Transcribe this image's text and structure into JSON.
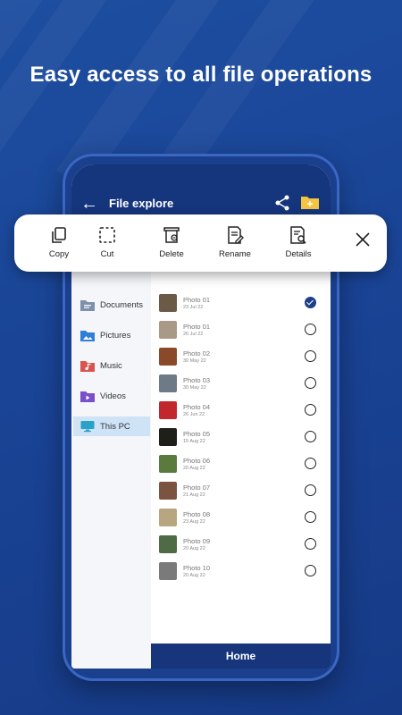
{
  "headline": "Easy access to all file operations",
  "appbar": {
    "title": "File explore"
  },
  "toolbar": {
    "items": [
      {
        "label": "Copy",
        "icon": "copy-icon"
      },
      {
        "label": "Cut",
        "icon": "cut-icon"
      },
      {
        "label": "Delete",
        "icon": "delete-icon"
      },
      {
        "label": "Rename",
        "icon": "rename-icon"
      },
      {
        "label": "Details",
        "icon": "details-icon"
      }
    ],
    "close_icon": "close-icon"
  },
  "sidebar": {
    "items": [
      {
        "label": "Documents",
        "icon": "documents-folder-icon",
        "color": "#7f8fae"
      },
      {
        "label": "Pictures",
        "icon": "pictures-folder-icon",
        "color": "#2f7fd8"
      },
      {
        "label": "Music",
        "icon": "music-folder-icon",
        "color": "#d9534f"
      },
      {
        "label": "Videos",
        "icon": "videos-folder-icon",
        "color": "#7b4fc9"
      },
      {
        "label": "This PC",
        "icon": "monitor-icon",
        "color": "#2aa1c9"
      }
    ],
    "active_index": 4
  },
  "photos": [
    {
      "name": "Photo 01",
      "date": "23 Jul 22",
      "checked": true,
      "thumb": "#6b5a45"
    },
    {
      "name": "Photo 01",
      "date": "26 Jul 22",
      "checked": false,
      "thumb": "#a89a86"
    },
    {
      "name": "Photo 02",
      "date": "30 May 22",
      "checked": false,
      "thumb": "#8a4a2a"
    },
    {
      "name": "Photo 03",
      "date": "30 May 22",
      "checked": false,
      "thumb": "#6e7a86"
    },
    {
      "name": "Photo 04",
      "date": "26 Jun 22",
      "checked": false,
      "thumb": "#c2272b"
    },
    {
      "name": "Photo 05",
      "date": "15 Aug 22",
      "checked": false,
      "thumb": "#1f1f1a"
    },
    {
      "name": "Photo 06",
      "date": "20 Aug 22",
      "checked": false,
      "thumb": "#5b7a3e"
    },
    {
      "name": "Photo 07",
      "date": "21 Aug 22",
      "checked": false,
      "thumb": "#7a5440"
    },
    {
      "name": "Photo 08",
      "date": "23 Aug 22",
      "checked": false,
      "thumb": "#b8a680"
    },
    {
      "name": "Photo 09",
      "date": "20 Aug 22",
      "checked": false,
      "thumb": "#4f6b45"
    },
    {
      "name": "Photo 10",
      "date": "20 Aug 22",
      "checked": false,
      "thumb": "#7a7a7a"
    }
  ],
  "bottom_bar": {
    "label": "Home"
  },
  "colors": {
    "background": "#1a4496",
    "appbar": "#15357d",
    "accent": "#1d3f87",
    "active_sidebar": "#cfe3f7"
  }
}
